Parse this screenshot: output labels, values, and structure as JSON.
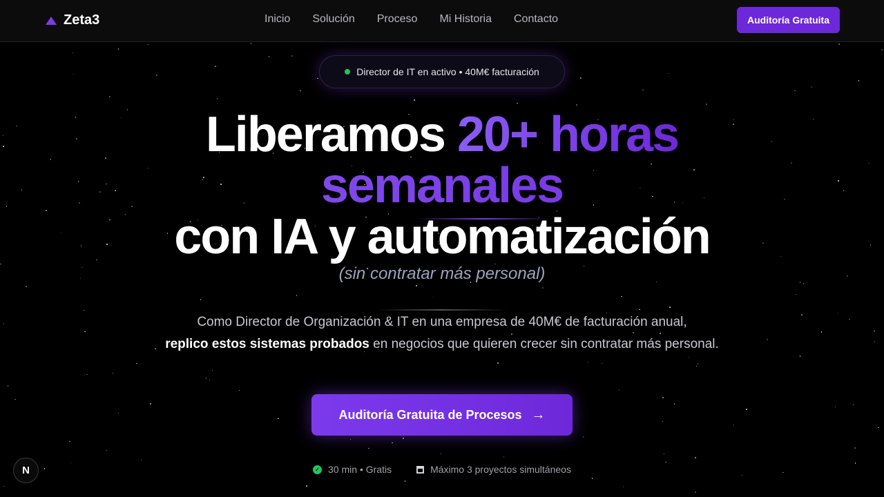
{
  "brand": {
    "name": "Zeta3"
  },
  "nav": {
    "links": [
      "Inicio",
      "Solución",
      "Proceso",
      "Mi Historia",
      "Contacto"
    ],
    "cta_label": "Auditoría Gratuita"
  },
  "hero": {
    "badge_text": "Director de IT en activo • 40M€ facturación",
    "headline": {
      "line1_plain": "Liberamos ",
      "line1_accent": "20+ horas",
      "line2_accent": "semanales",
      "line3_plain": "con IA y automatización"
    },
    "subtitle": "(sin contratar más personal)",
    "description": {
      "part1": "Como Director de Organización & IT en una empresa de 40M€ de facturación anual,",
      "bold": "replico estos sistemas probados",
      "part2": " en negocios que quieren crecer sin contratar más personal."
    },
    "cta_label": "Auditoría Gratuita de Procesos",
    "cta_arrow": "→",
    "footnotes": {
      "duration": "30 min • Gratis",
      "limit": "Máximo 3 proyectos simultáneos"
    }
  },
  "dev_badge": {
    "label": "N"
  },
  "colors": {
    "accent": "#7c3aed",
    "status_green": "#22c55e",
    "background": "#000000"
  }
}
